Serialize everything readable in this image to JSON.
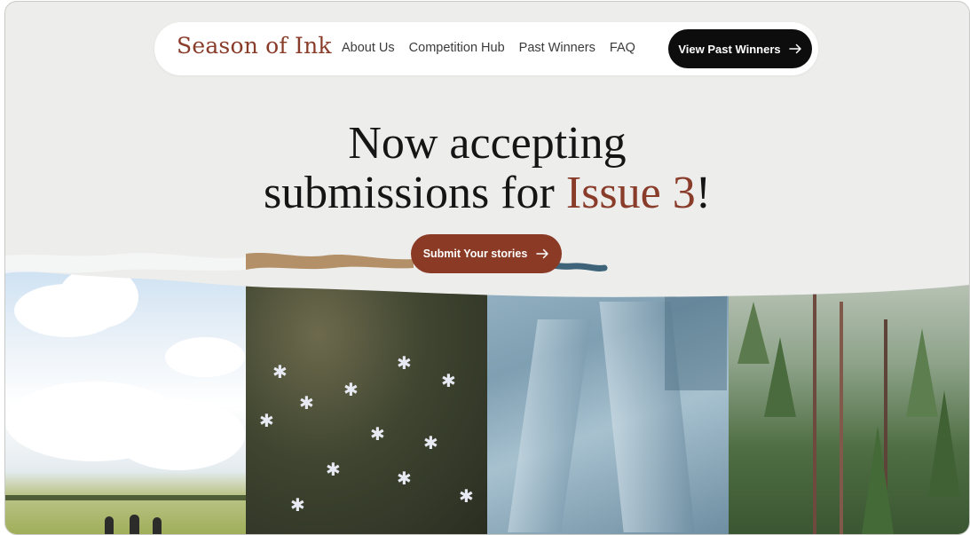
{
  "brand": {
    "name": "Season of Ink"
  },
  "nav": {
    "links": [
      "About Us",
      "Competition Hub",
      "Past Winners",
      "FAQ"
    ],
    "cta_label": "View Past Winners",
    "cta_icon": "arrow-right-icon"
  },
  "hero": {
    "title_line1": "Now accepting",
    "title_line2_prefix": "submissions for ",
    "title_accent": "Issue 3",
    "title_suffix": "!",
    "cta_label": "Submit Your stories",
    "cta_icon": "arrow-right-icon"
  },
  "colors": {
    "accent": "#8a3c2a",
    "button_dark": "#0d0d0d",
    "background": "#ededeb"
  },
  "photos": [
    "summer-field-photo",
    "autumn-flowers-photo",
    "winter-snow-trees-photo",
    "spring-forest-photo"
  ]
}
